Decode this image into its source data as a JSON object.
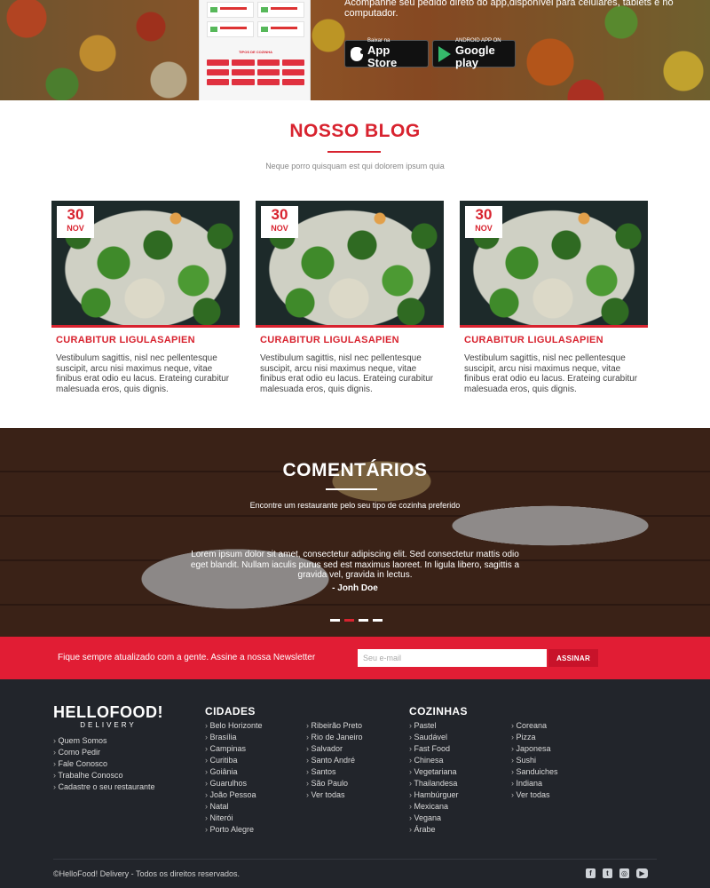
{
  "hero": {
    "tagline": "Acompanhe seu pedido direto do app,disponível para celulares, tablets e no computador.",
    "phone_title": "TIPOS DE COZINHA",
    "appstore_small": "Baixar na",
    "appstore_big": "App Store",
    "google_small": "ANDROID APP ON",
    "google_big": "Google play"
  },
  "blog": {
    "title": "NOSSO BLOG",
    "subtitle": "Neque porro quisquam est qui dolorem ipsum quia",
    "posts": [
      {
        "day": "30",
        "month": "NOV",
        "title": "CURABITUR LIGULASAPIEN",
        "body": "Vestibulum sagittis, nisl nec pellentesque suscipit, arcu nisi maximus neque, vitae finibus erat odio eu lacus. Erateing curabitur malesuada eros, quis dignis."
      },
      {
        "day": "30",
        "month": "NOV",
        "title": "CURABITUR LIGULASAPIEN",
        "body": "Vestibulum sagittis, nisl nec pellentesque suscipit, arcu nisi maximus neque, vitae finibus erat odio eu lacus. Erateing curabitur malesuada eros, quis dignis."
      },
      {
        "day": "30",
        "month": "NOV",
        "title": "CURABITUR LIGULASAPIEN",
        "body": "Vestibulum sagittis, nisl nec pellentesque suscipit, arcu nisi maximus neque, vitae finibus erat odio eu lacus. Erateing curabitur malesuada eros, quis dignis."
      }
    ]
  },
  "testimonials": {
    "title": "COMENTÁRIOS",
    "subtitle": "Encontre um restaurante pelo seu tipo de cozinha preferido",
    "quote": "Lorem ipsum dolor sit amet, consectetur adipiscing elit. Sed consectetur mattis odio eget blandit. Nullam iaculis purus sed est maximus laoreet. In ligula libero, sagittis a gravida vel, gravida in lectus.",
    "author": "- Jonh Doe",
    "slides": 4,
    "active_slide": 2
  },
  "newsletter": {
    "text": "Fique sempre atualizado com a gente. Assine a nossa Newsletter",
    "placeholder": "Seu e-mail",
    "button": "ASSINAR"
  },
  "footer": {
    "logo_main": "HELLOFOOD!",
    "logo_sub": "DELIVERY",
    "links": [
      "Quem Somos",
      "Como Pedir",
      "Fale Conosco",
      "Trabalhe Conosco",
      "Cadastre o seu restaurante"
    ],
    "cities_heading": "CIDADES",
    "cities_col1": [
      "Belo Horizonte",
      "Brasília",
      "Campinas",
      "Curitiba",
      "Goiânia",
      "Guarulhos",
      "João Pessoa",
      "Natal",
      "Niterói",
      "Porto Alegre"
    ],
    "cities_col2": [
      "Ribeirão Preto",
      "Rio de Janeiro",
      "Salvador",
      "Santo André",
      "Santos",
      "São Paulo",
      "Ver todas"
    ],
    "cuisines_heading": "COZINHAS",
    "cuisines_col1": [
      "Pastel",
      "Saudável",
      "Fast Food",
      "Chinesa",
      "Vegetariana",
      "Thailandesa",
      "Hambúrguer",
      "Mexicana",
      "Vegana",
      "Árabe"
    ],
    "cuisines_col2": [
      "Coreana",
      "Pizza",
      "Japonesa",
      "Sushi",
      "Sanduiches",
      "Indiana",
      "Ver todas"
    ],
    "copyright": "©HelloFood! Delivery - Todos os direitos reservados.",
    "social_icons": [
      "facebook-icon",
      "twitter-icon",
      "instagram-icon",
      "youtube-icon"
    ]
  },
  "colors": {
    "accent": "#d8232f",
    "newsletter_bg": "#e11d34",
    "footer_bg": "#22252b"
  }
}
